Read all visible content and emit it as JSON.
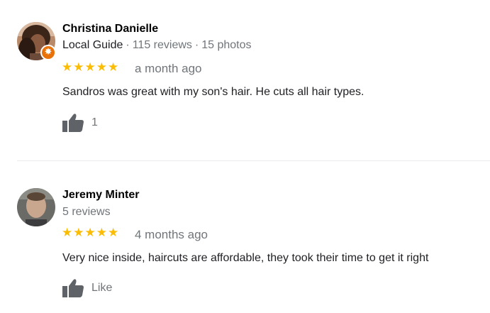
{
  "reviews": [
    {
      "author": "Christina Danielle",
      "guide_label": "Local Guide",
      "reviews_count": "115 reviews",
      "photos_count": "15 photos",
      "rating": 5,
      "stars": "★★★★★",
      "date": "a month ago",
      "text": "Sandros was great with my son's hair. He cuts all hair types.",
      "like_label": "1",
      "badge_icon": "local-guide-star-icon"
    },
    {
      "author": "Jeremy Minter",
      "reviews_count": "5 reviews",
      "rating": 5,
      "stars": "★★★★★",
      "date": "4 months ago",
      "text": "Very nice inside, haircuts are affordable, they took their time to get it right",
      "like_label": "Like"
    }
  ],
  "icons": {
    "like": "thumbs-up-icon",
    "rating": "star-icon"
  },
  "colors": {
    "star": "#fbbc04",
    "badge": "#e8710a",
    "secondary_text": "#70757a",
    "divider": "#e8eaed"
  }
}
